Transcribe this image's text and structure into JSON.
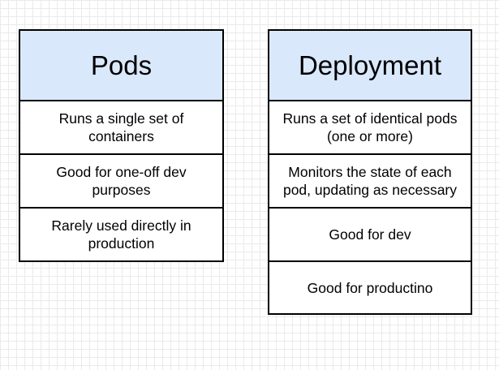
{
  "pods": {
    "title": "Pods",
    "rows": [
      "Runs a single set of\ncontainers",
      "Good for one-off dev\npurposes",
      "Rarely used directly in\nproduction"
    ]
  },
  "deployment": {
    "title": "Deployment",
    "rows": [
      "Runs a set of identical pods\n(one or more)",
      "Monitors the state of each\npod, updating as necessary",
      "Good for dev",
      "Good for productino"
    ]
  },
  "colors": {
    "header_fill": "#dae8fc",
    "border": "#000000",
    "grid": "#eaeaea"
  }
}
